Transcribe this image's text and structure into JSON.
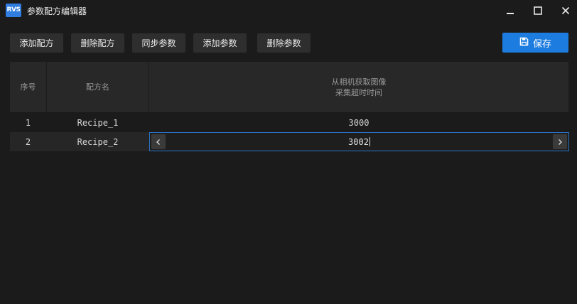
{
  "app": {
    "logo_text": "RVS",
    "title": "参数配方编辑器"
  },
  "toolbar": {
    "add_recipe": "添加配方",
    "delete_recipe": "删除配方",
    "sync_params": "同步参数",
    "add_param": "添加参数",
    "delete_param": "删除参数",
    "save": "保存"
  },
  "table": {
    "headers": {
      "index": "序号",
      "recipe_name": "配方名",
      "param_line1": "从相机获取图像",
      "param_line2": "采集超时时间"
    },
    "rows": [
      {
        "index": "1",
        "name": "Recipe_1",
        "value": "3000"
      },
      {
        "index": "2",
        "name": "Recipe_2",
        "value": "3002"
      }
    ]
  },
  "colors": {
    "accent": "#1d7ce0",
    "background": "#1b1b1b",
    "header_bg": "#282828",
    "selected_row_bg": "#262626"
  },
  "icons": [
    "app-logo",
    "minimize-icon",
    "maximize-icon",
    "close-icon",
    "save-icon",
    "chevron-left-icon",
    "chevron-right-icon"
  ]
}
